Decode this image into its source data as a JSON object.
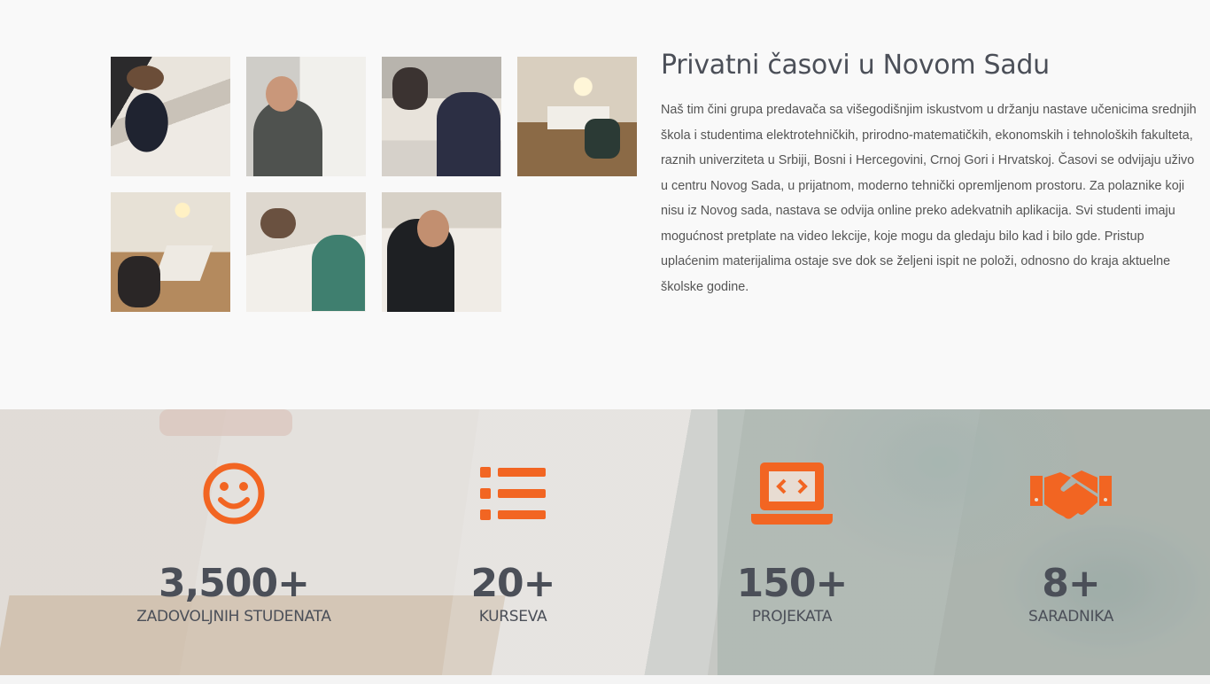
{
  "about": {
    "title": "Privatni časovi u Novom Sadu",
    "body": "Naš tim čini grupa predavača sa višegodišnjim iskustvom u držanju nastave učenicima srednjih škola  i studentima elektrotehničkih, prirodno-matematičkih, ekonomskih i tehnoloških fakulteta, raznih univerziteta u Srbiji, Bosni i Hercegovini, Crnoj Gori i Hrvatskoj. Časovi se odvijaju uživo u centru Novog Sada, u prijatnom, moderno tehnički opremljenom prostoru. Za polaznike koji nisu iz Novog sada, nastava se odvija online preko adekvatnih aplikacija. Svi studenti imaju mogućnost pretplate na video lekcije, koje mogu da gledaju bilo kad i bilo gde. Pristup uplaćenim materijalima ostaje sve dok se željeni ispit ne položi, odnosno do kraja aktuelne školske godine."
  },
  "gallery": {
    "photos": [
      {
        "icon": "classroom-photo"
      },
      {
        "icon": "teacher-whiteboard-photo"
      },
      {
        "icon": "students-desk-photo"
      },
      {
        "icon": "classroom-wide-photo"
      },
      {
        "icon": "classroom-laptop-photo"
      },
      {
        "icon": "students-writing-photo"
      },
      {
        "icon": "student-exam-photo"
      }
    ]
  },
  "stats": {
    "accent_color": "#f26522",
    "items": [
      {
        "icon": "smiley-icon",
        "value": "3,500+",
        "label": "ZADOVOLJNIH STUDENATA"
      },
      {
        "icon": "list-icon",
        "value": "20+",
        "label": "KURSEVA"
      },
      {
        "icon": "laptop-code-icon",
        "value": "150+",
        "label": "PROJEKATA"
      },
      {
        "icon": "handshake-icon",
        "value": "8+",
        "label": "SARADNIKA"
      }
    ]
  }
}
